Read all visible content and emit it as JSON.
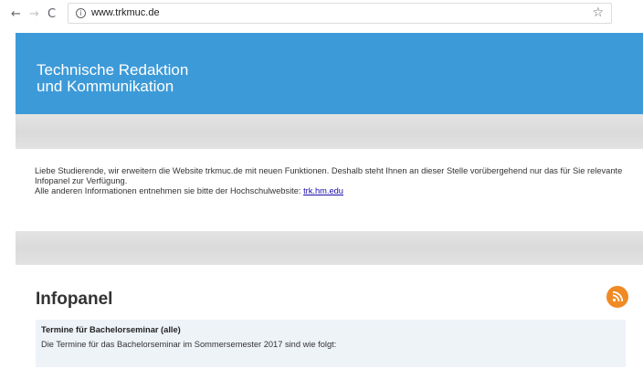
{
  "browser": {
    "url": "www.trkmuc.de",
    "back_icon": "arrow-left-icon",
    "forward_icon": "arrow-right-icon",
    "reload_icon": "reload-icon",
    "info_icon": "info-icon",
    "bookmark_icon": "star-icon"
  },
  "header": {
    "title": "Technische Redaktion\nund Kommunikation",
    "background": "#3d9ad8"
  },
  "notice": {
    "line1": "Liebe Studierende, wir erweitern die Website trkmuc.de mit neuen Funktionen. Deshalb steht Ihnen an dieser Stelle vorübergehend nur das für Sie relevante Infopanel zur Verfügung.",
    "line2_prefix": "Alle anderen Informationen entnehmen sie bitte der Hochschulwebsite: ",
    "link_text": "trk.hm.edu"
  },
  "infopanel": {
    "heading": "Infopanel",
    "rss_icon": "rss-feed-icon",
    "rss_color": "#f08a24",
    "entries": [
      {
        "title": "Termine für Bachelorseminar (alle)",
        "text": "Die Termine für das Bachelorseminar im Sommersemester 2017 sind wie folgt:"
      }
    ]
  }
}
